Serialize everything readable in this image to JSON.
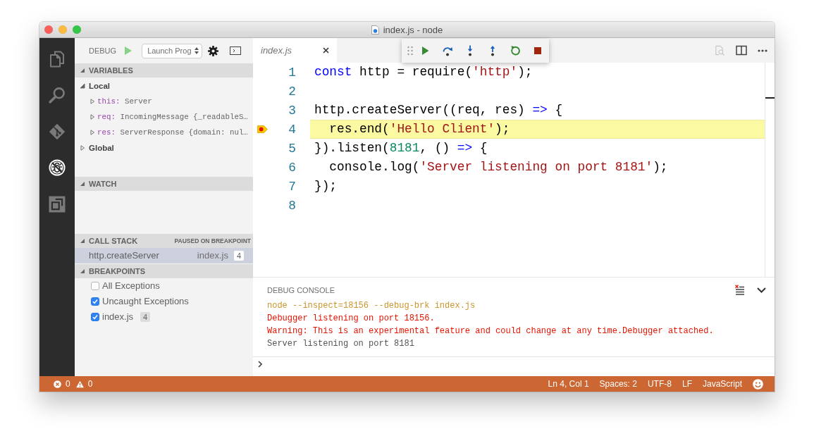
{
  "window": {
    "title": "index.js - node"
  },
  "activity_bar": [
    {
      "selected": false
    },
    {
      "selected": false
    },
    {
      "selected": false
    },
    {
      "selected": true
    },
    {
      "selected": false
    }
  ],
  "sidebar": {
    "title": "DEBUG",
    "config": "Launch Prog",
    "variables": {
      "title": "VARIABLES",
      "expanded": true,
      "scopes": [
        {
          "name": "Local",
          "expanded": true,
          "children": [
            {
              "name": "this:",
              "value": "Server",
              "expanded": false
            },
            {
              "name": "req:",
              "value": "IncomingMessage {_readableS…",
              "expanded": false
            },
            {
              "name": "res:",
              "value": "ServerResponse {domain: nul…",
              "expanded": false
            }
          ]
        },
        {
          "name": "Global",
          "expanded": false
        }
      ]
    },
    "watch": {
      "title": "WATCH",
      "expanded": true
    },
    "call_stack": {
      "title": "CALL STACK",
      "expanded": true,
      "status": "PAUSED ON BREAKPOINT",
      "frames": [
        {
          "name": "http.createServer",
          "file": "index.js",
          "line": "4",
          "selected": true
        }
      ]
    },
    "breakpoints": {
      "title": "BREAKPOINTS",
      "expanded": true,
      "items": [
        {
          "label": "All Exceptions",
          "checked": false
        },
        {
          "label": "Uncaught Exceptions",
          "checked": true
        },
        {
          "label": "index.js",
          "checked": true,
          "line": "4"
        }
      ]
    }
  },
  "editor": {
    "tabs": [
      {
        "label": "index.js",
        "selected": true,
        "preview": true
      }
    ],
    "lines": [
      {
        "number": "1",
        "current": false,
        "breakpoint": false,
        "tokens": [
          {
            "text": "const",
            "kind": "keyword"
          },
          {
            "text": " http = require(",
            "kind": "plain"
          },
          {
            "text": "'http'",
            "kind": "string"
          },
          {
            "text": ");",
            "kind": "plain"
          }
        ]
      },
      {
        "number": "2",
        "current": false,
        "breakpoint": false
      },
      {
        "number": "3",
        "current": false,
        "breakpoint": false,
        "tokens": [
          {
            "text": "http.createServer((req, res) ",
            "kind": "plain"
          },
          {
            "text": "=>",
            "kind": "keyword"
          },
          {
            "text": " {",
            "kind": "plain"
          }
        ]
      },
      {
        "number": "4",
        "current": true,
        "breakpoint": true,
        "tokens": [
          {
            "text": "  res.end(",
            "kind": "plain"
          },
          {
            "text": "'Hello Client'",
            "kind": "string"
          },
          {
            "text": ");",
            "kind": "plain"
          }
        ]
      },
      {
        "number": "5",
        "current": false,
        "breakpoint": false,
        "tokens": [
          {
            "text": "}).listen(",
            "kind": "plain"
          },
          {
            "text": "8181",
            "kind": "number"
          },
          {
            "text": ", () ",
            "kind": "plain"
          },
          {
            "text": "=>",
            "kind": "keyword"
          },
          {
            "text": " {",
            "kind": "plain"
          }
        ]
      },
      {
        "number": "6",
        "current": false,
        "breakpoint": false,
        "tokens": [
          {
            "text": "  console.log(",
            "kind": "plain"
          },
          {
            "text": "'Server listening on port 8181'",
            "kind": "string"
          },
          {
            "text": ");",
            "kind": "plain"
          }
        ]
      },
      {
        "number": "7",
        "current": false,
        "breakpoint": false,
        "tokens": [
          {
            "text": "});",
            "kind": "plain"
          }
        ]
      },
      {
        "number": "8",
        "current": false,
        "breakpoint": false
      }
    ]
  },
  "panel": {
    "title": "DEBUG CONSOLE",
    "lines": [
      {
        "text": "node --inspect=18156 --debug-brk index.js",
        "kind": "command"
      },
      {
        "text": "Debugger listening on port 18156.",
        "kind": "error"
      },
      {
        "text": "Warning: This is an experimental feature and could change at any time.Debugger attached.",
        "kind": "error"
      },
      {
        "text": "Server listening on port 8181",
        "kind": "log"
      }
    ]
  },
  "status_bar": {
    "errors": "0",
    "warnings": "0",
    "items": [
      "Ln 4, Col 1",
      "Spaces: 2",
      "UTF-8",
      "LF",
      "JavaScript"
    ]
  }
}
